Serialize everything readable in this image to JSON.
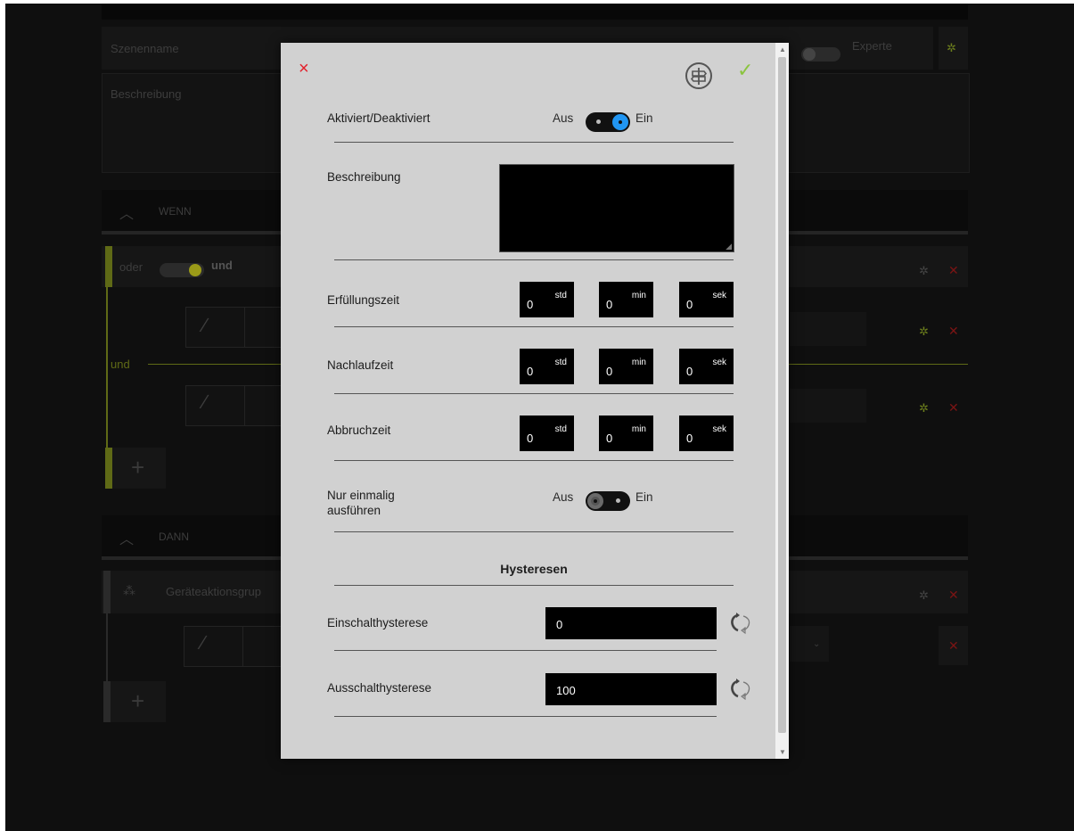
{
  "background": {
    "scene_name_label": "Szenenname",
    "expert_label": "Experte",
    "description_label": "Beschreibung",
    "wenn_label": "WENN",
    "dann_label": "DANN",
    "oder_label": "oder",
    "und_label": "und",
    "und_divider": "und",
    "action_group_label": "Geräteaktionsgrup",
    "plus": "+"
  },
  "dialog": {
    "close_icon": "×",
    "confirm_icon": "✓",
    "active": {
      "label": "Aktiviert/Deaktiviert",
      "off": "Aus",
      "on": "Ein",
      "state": "on"
    },
    "description": {
      "label": "Beschreibung",
      "value": ""
    },
    "fulfillment": {
      "label": "Erfüllungszeit",
      "hours": "0",
      "minutes": "0",
      "seconds": "0"
    },
    "followup": {
      "label": "Nachlaufzeit",
      "hours": "0",
      "minutes": "0",
      "seconds": "0"
    },
    "abort": {
      "label": "Abbruchzeit",
      "hours": "0",
      "minutes": "0",
      "seconds": "0"
    },
    "units": {
      "hours": "std",
      "minutes": "min",
      "seconds": "sek"
    },
    "once": {
      "label_line1": "Nur einmalig",
      "label_line2": "ausführen",
      "off": "Aus",
      "on": "Ein",
      "state": "off"
    },
    "hysteresis_title": "Hysteresen",
    "switch_on_hysteresis": {
      "label": "Einschalthysterese",
      "value": "0"
    },
    "switch_off_hysteresis": {
      "label": "Ausschalthysterese",
      "value": "100"
    }
  },
  "colors": {
    "accent_blue": "#2196f3",
    "close_red": "#e3202b",
    "confirm_green": "#8bc43f",
    "olive": "#c8c832"
  }
}
